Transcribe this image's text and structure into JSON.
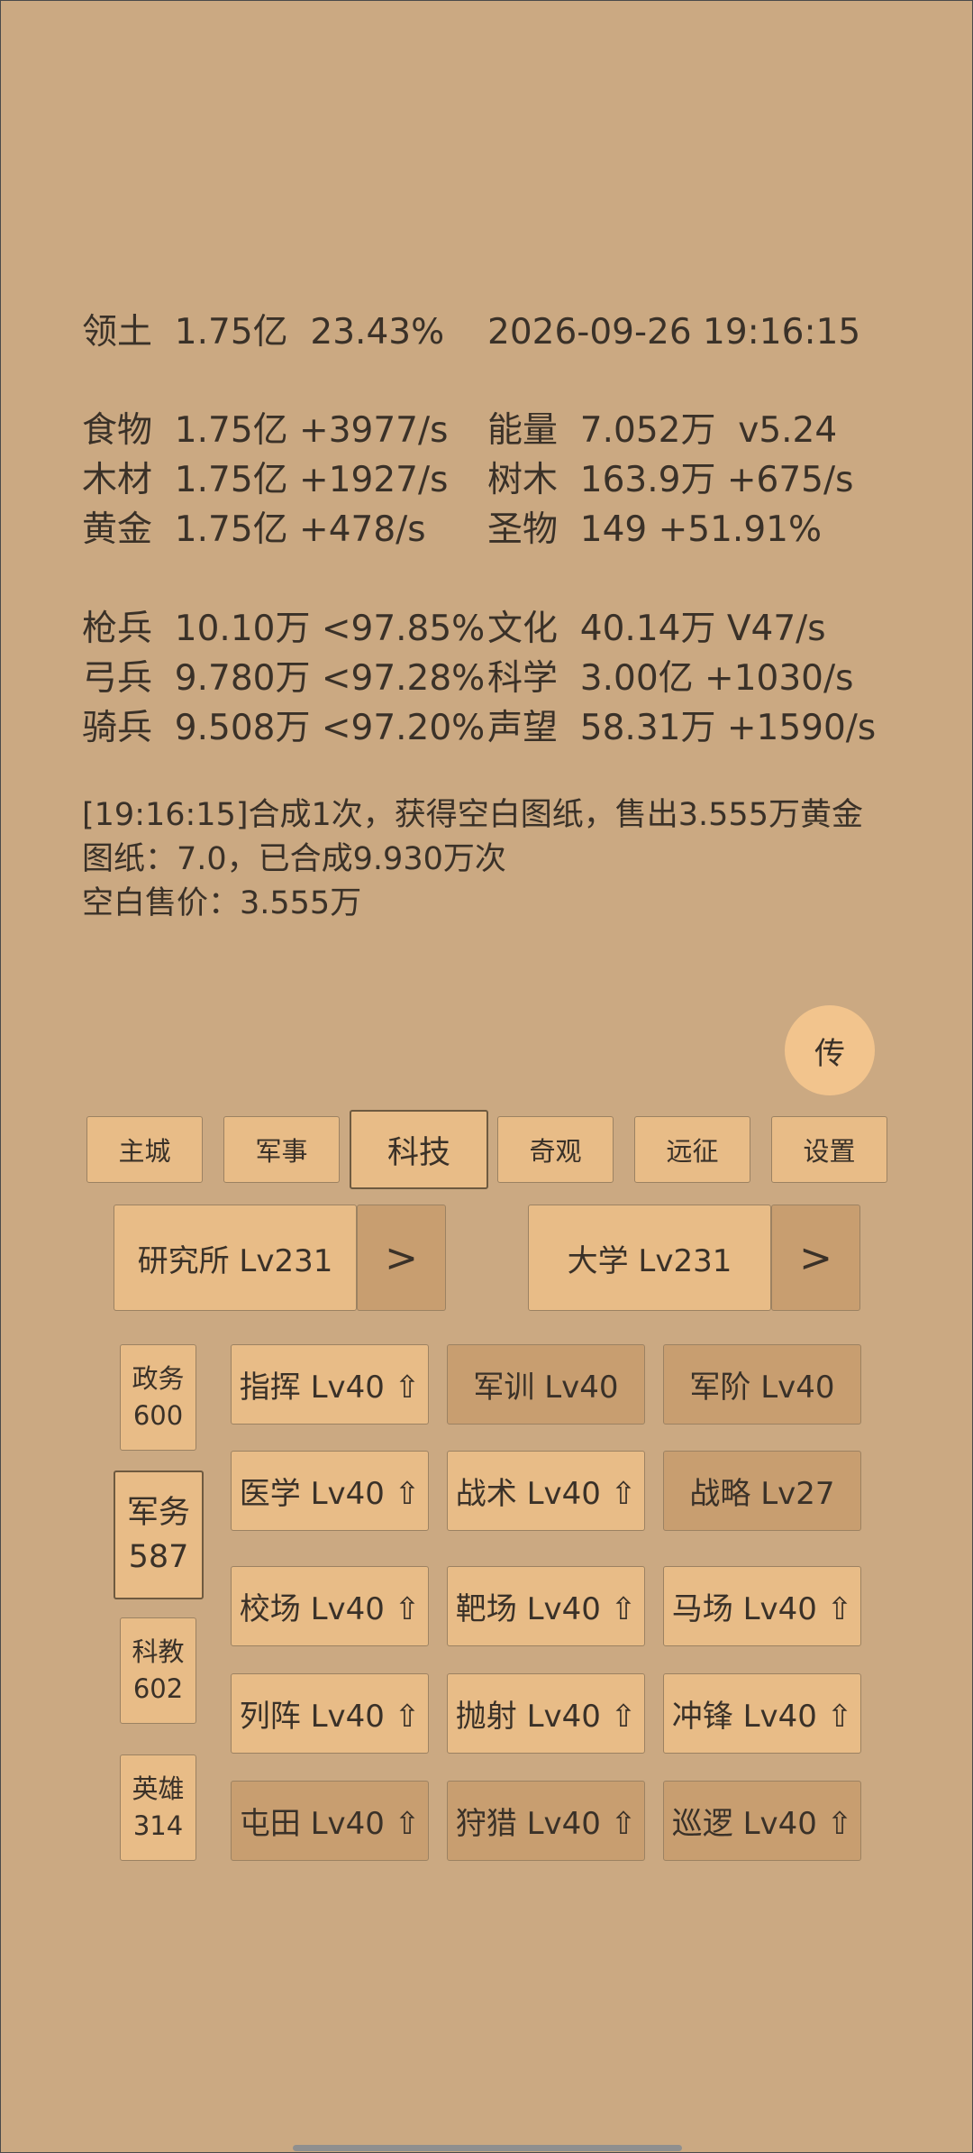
{
  "stats": {
    "territory": "领土  1.75亿  23.43%",
    "datetime": "2026-09-26 19:16:15",
    "food": "食物  1.75亿 +3977/s",
    "energy": "能量  7.052万  v5.24",
    "wood": "木材  1.75亿 +1927/s",
    "trees": "树木  163.9万 +675/s",
    "gold": "黄金  1.75亿 +478/s",
    "relic": "圣物  149 +51.91%",
    "spearman": "枪兵  10.10万 <97.85%",
    "culture": "文化  40.14万 V47/s",
    "archer": "弓兵  9.780万 <97.28%",
    "science": "科学  3.00亿 +1030/s",
    "cavalry": "骑兵  9.508万 <97.20%",
    "prestige": "声望  58.31万 +1590/s"
  },
  "log": {
    "line1": "[19:16:15]合成1次，获得空白图纸，售出3.555万黄金",
    "line2": "图纸：7.0，已合成9.930万次",
    "line3": "空白售价：3.555万"
  },
  "float_button": "传",
  "tabs": [
    "主城",
    "军事",
    "科技",
    "奇观",
    "远征",
    "设置"
  ],
  "buildings": {
    "institute": "研究所 Lv231",
    "university": "大学 Lv231",
    "next": ">"
  },
  "sidebar": [
    {
      "label": "政务\n600"
    },
    {
      "label": "军务\n587"
    },
    {
      "label": "科教\n602"
    },
    {
      "label": "英雄\n314"
    }
  ],
  "techs": [
    "指挥 Lv40 ⇧",
    "军训 Lv40",
    "军阶 Lv40",
    "医学 Lv40 ⇧",
    "战术 Lv40 ⇧",
    "战略 Lv27",
    "校场 Lv40 ⇧",
    "靶场 Lv40 ⇧",
    "马场 Lv40 ⇧",
    "列阵 Lv40 ⇧",
    "抛射 Lv40 ⇧",
    "冲锋 Lv40 ⇧",
    "屯田 Lv40 ⇧",
    "狩猎 Lv40 ⇧",
    "巡逻 Lv40 ⇧"
  ],
  "colors": {
    "background": "#cba982",
    "button_light": "#e8bc87",
    "button_dark": "#c89e70",
    "text": "#3a3128"
  }
}
